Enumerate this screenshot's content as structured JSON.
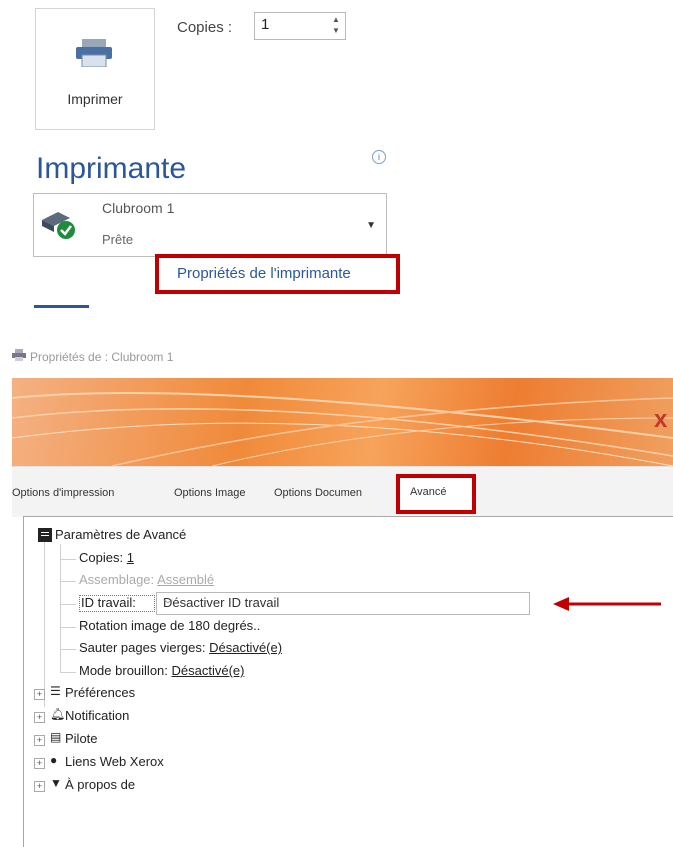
{
  "print_panel": {
    "print_button_label": "Imprimer",
    "copies_label": "Copies :",
    "copies_value": "1",
    "printer_section_title": "Imprimante",
    "info_icon": "i",
    "printer_name": "Clubroom 1",
    "printer_status": "Prête",
    "printer_properties_link": "Propriétés de l'imprimante"
  },
  "dialog": {
    "title": "Propriétés de : Clubroom 1",
    "close_glyph": "x",
    "tabs": [
      {
        "label": "Options d'impression"
      },
      {
        "label": "Options Image"
      },
      {
        "label": "Options Documen"
      },
      {
        "label": "Avancé"
      }
    ],
    "tree": {
      "root_label": "Paramètres de Avancé",
      "copies_label": "Copies:",
      "copies_value": "1",
      "collation_label": "Assemblage:",
      "collation_value": "Assemblé",
      "job_id_label": "ID travail:",
      "job_id_value": "Désactiver ID travail",
      "rotation_label": "Rotation image de 180 degrés..",
      "skip_blank_label": "Sauter pages vierges:",
      "skip_blank_value": "Désactivé(e)",
      "draft_label": "Mode brouillon:",
      "draft_value": "Désactivé(e)",
      "groups": [
        {
          "label": "Préférences",
          "icon": "preferences-icon"
        },
        {
          "label": "Notification",
          "icon": "bell-icon"
        },
        {
          "label": "Pilote",
          "icon": "driver-icon"
        },
        {
          "label": "Liens Web Xerox",
          "icon": "globe-icon"
        },
        {
          "label": "À propos de",
          "icon": "chat-icon"
        }
      ]
    }
  },
  "colors": {
    "accent_blue": "#2b579a",
    "highlight_red": "#c00000",
    "banner_orange": "#ed7d31"
  }
}
